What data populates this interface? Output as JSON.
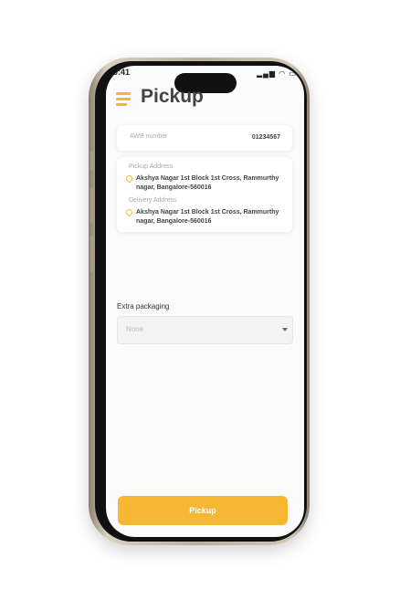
{
  "status_bar": {
    "time": "9:41",
    "icons": "signal wifi battery"
  },
  "header": {
    "title": "Pickup",
    "menu_icon": "hamburger-menu-icon"
  },
  "awb": {
    "label": "AWB number",
    "value": "01234567"
  },
  "addresses": {
    "pickup_label": "Pickup Address",
    "pickup_value": "Akshya Nagar 1st Block 1st Cross, Rammurthy nagar, Bangalore-560016",
    "delivery_label": "Delivery Address",
    "delivery_value": "Akshya Nagar 1st Block 1st Cross, Rammurthy nagar, Bangalore-560016"
  },
  "extra_packaging": {
    "label": "Extra packaging",
    "selected": "None"
  },
  "actions": {
    "pickup_label": "Pickup"
  },
  "colors": {
    "accent": "#f7b733"
  }
}
